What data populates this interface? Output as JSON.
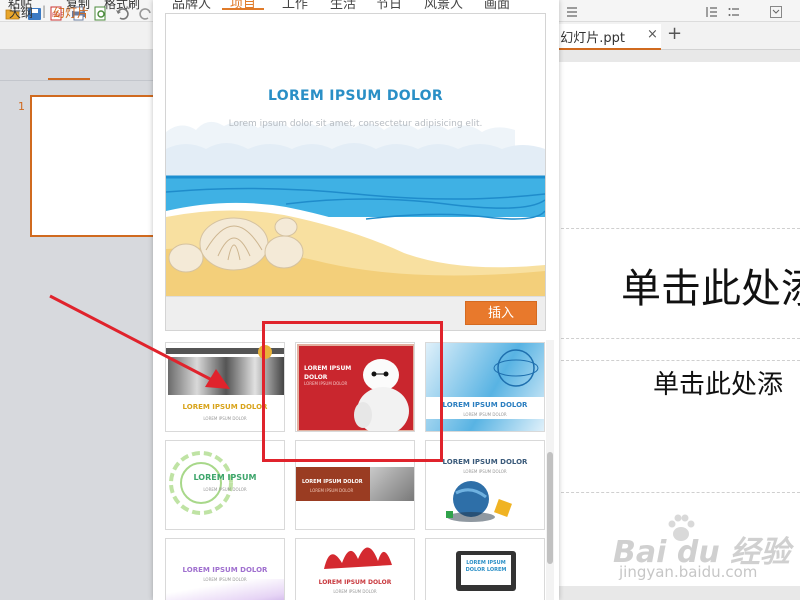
{
  "ribbon": {
    "paste_label": "粘贴",
    "copy_label": "复制",
    "format_painter_label": "格式刷"
  },
  "left_panel": {
    "tab_outline": "大纲",
    "tab_separator": "|",
    "tab_slides": "幻灯片",
    "slide_number": "1"
  },
  "document": {
    "tab_label": "t 幻灯片.ppt",
    "tab_close": "×",
    "tab_add": "+",
    "title_placeholder": "单击此处添",
    "subtitle_placeholder": "单击此处添"
  },
  "picker": {
    "tabs": [
      "品牌人",
      "项目",
      "工作",
      "生活",
      "节日",
      "风景人",
      "画面"
    ],
    "active_tab_index": 1,
    "preview": {
      "title": "LOREM IPSUM DOLOR",
      "subtitle": "Lorem ipsum dolor sit amet, consectetur adipisicing elit."
    },
    "insert_label": "插入",
    "templates": [
      {
        "label": "LOREM IPSUM DOLOR",
        "sub": "LOREM IPSUM DOLOR"
      },
      {
        "label": "LOREM IPSUM DOLOR",
        "sub": "LOREM IPSUM DOLOR"
      },
      {
        "label": "LOREM IPSUM DOLOR",
        "sub": "LOREM IPSUM DOLOR"
      },
      {
        "label": "LOREM IPSUM",
        "sub": "LOREM IPSUM DOLOR"
      },
      {
        "label": "LOREM IPSUM DOLOR",
        "sub": "LOREM IPSUM DOLOR"
      },
      {
        "label": "LOREM IPSUM DOLOR",
        "sub": "LOREM IPSUM DOLOR"
      },
      {
        "label": "LOREM IPSUM DOLOR",
        "sub": "LOREM IPSUM DOLOR"
      },
      {
        "label": "LOREM IPSUM DOLOR",
        "sub": "LOREM IPSUM DOLOR"
      },
      {
        "label": "LOREM IPSUM DOLOR LOREM",
        "sub": ""
      }
    ]
  },
  "watermark": {
    "logo_text": "Bai du 经验",
    "url": "jingyan.baidu.com"
  },
  "colors": {
    "accent_orange": "#e8792c",
    "title_blue": "#2a8fc6",
    "annotation_red": "#e0232c"
  }
}
